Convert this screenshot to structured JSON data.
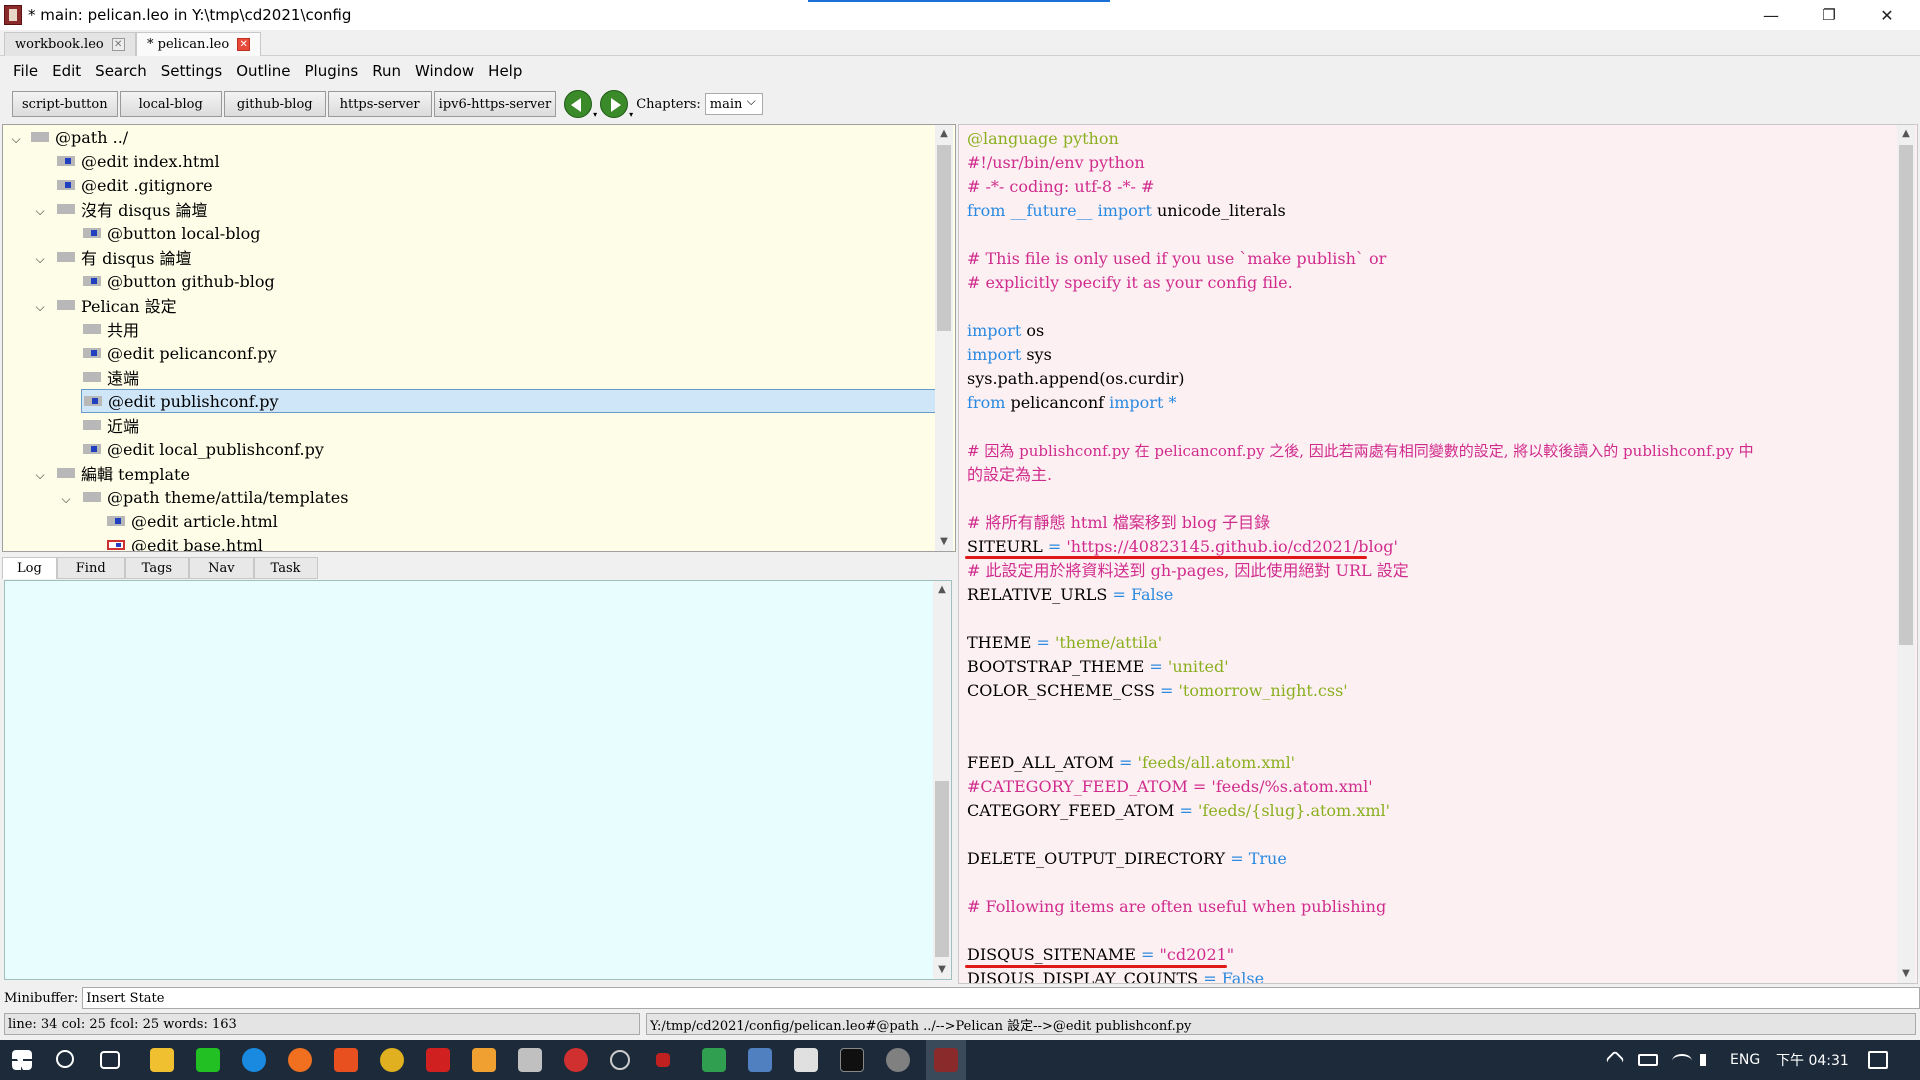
{
  "window": {
    "title": "* main: pelican.leo in Y:\\tmp\\cd2021\\config",
    "minimize": "—",
    "restore": "❐",
    "close": "✕"
  },
  "doc_tabs": [
    {
      "label": "workbook.leo",
      "close": "✕"
    },
    {
      "label": "* pelican.leo",
      "close": "✕"
    }
  ],
  "menu": [
    "File",
    "Edit",
    "Search",
    "Settings",
    "Outline",
    "Plugins",
    "Run",
    "Window",
    "Help"
  ],
  "toolbar": {
    "buttons": [
      "script-button",
      "local-blog",
      "github-blog",
      "https-server",
      "ipv6-https-server"
    ],
    "chapters_label": "Chapters:",
    "chapters_value": "main",
    "arrow_drop": "▾"
  },
  "outline": {
    "chev_open": "⌵",
    "nodes": [
      {
        "text": "@path ../"
      },
      {
        "text": "@edit index.html"
      },
      {
        "text": "@edit .gitignore"
      },
      {
        "text": "沒有 disqus 論壇"
      },
      {
        "text": "@button local-blog"
      },
      {
        "text": "有 disqus 論壇"
      },
      {
        "text": "@button github-blog"
      },
      {
        "text": "Pelican 設定"
      },
      {
        "text": "共用"
      },
      {
        "text": "@edit pelicanconf.py"
      },
      {
        "text": "遠端"
      },
      {
        "text": "@edit publishconf.py"
      },
      {
        "text": "近端"
      },
      {
        "text": "@edit local_publishconf.py"
      },
      {
        "text": "編輯 template"
      },
      {
        "text": "@path theme/attila/templates"
      },
      {
        "text": "@edit article.html"
      },
      {
        "text": "@edit base.html"
      }
    ]
  },
  "bottom_tabs": [
    "Log",
    "Find",
    "Tags",
    "Nav",
    "Task"
  ],
  "body": {
    "l1": "@language python",
    "l2": "#!/usr/bin/env python",
    "l3": "# -*- coding: utf-8 -*- #",
    "l4a": "from",
    "l4b": "__future__",
    "l4c": "import",
    "l4d": "unicode_literals",
    "l6": "# This file is only used if you use `make publish` or",
    "l7": "# explicitly specify it as your config file.",
    "l9a": "import",
    "l9b": "os",
    "l10a": "import",
    "l10b": "sys",
    "l11": "sys.path.append(os.curdir)",
    "l12a": "from",
    "l12b": "pelicanconf",
    "l12c": "import",
    "l12d": "*",
    "l14": "# 因為 publishconf.py 在 pelicanconf.py 之後, 因此若兩處有相同變數的設定, 將以較後讀入的 publishconf.py 中",
    "l15": "的設定為主.",
    "l17": "# 將所有靜態 html 檔案移到 blog 子目錄",
    "l18a": "SITEURL",
    "l18b": "=",
    "l18c": "'https://40823145.github.io/cd2021/blog'",
    "l19": "# 此設定用於將資料送到 gh-pages, 因此使用絕對 URL 設定",
    "l20a": "RELATIVE_URLS",
    "l20b": "=",
    "l20c": "False",
    "l22a": "THEME",
    "l22b": "=",
    "l22c": "'theme/attila'",
    "l23a": "BOOTSTRAP_THEME",
    "l23b": "=",
    "l23c": "'united'",
    "l24a": "COLOR_SCHEME_CSS",
    "l24b": "=",
    "l24c": "'tomorrow_night.css'",
    "l27a": "FEED_ALL_ATOM",
    "l27b": "=",
    "l27c": "'feeds/all.atom.xml'",
    "l28": "#CATEGORY_FEED_ATOM = 'feeds/%s.atom.xml'",
    "l29a": "CATEGORY_FEED_ATOM",
    "l29b": "=",
    "l29c": "'feeds/{slug}.atom.xml'",
    "l31a": "DELETE_OUTPUT_DIRECTORY",
    "l31b": "=",
    "l31c": "True",
    "l33": "# Following items are often useful when publishing",
    "l35a": "DISQUS_SITENAME",
    "l35b": "=",
    "l35c": "\"cd2021\"",
    "l36a": "DISQUS_DISPLAY_COUNTS",
    "l36b": "=",
    "l36c": "False"
  },
  "minibuffer": {
    "label": "Minibuffer:",
    "value": "Insert State"
  },
  "status": {
    "left": "line: 34 col: 25  fcol: 25 words: 163",
    "right": "Y:/tmp/cd2021/config/pelican.leo#@path ../-->Pelican 設定-->@edit publishconf.py"
  },
  "scroll": {
    "up": "▲",
    "down": "▼"
  },
  "taskbar": {
    "lang": "ENG",
    "time": "下午 04:31"
  },
  "colors": {
    "outline_bg": "#fefee8",
    "body_bg": "#fdf0f3",
    "log_bg": "#e8fefe",
    "comment": "#d02c8c",
    "keyword": "#2a8ae0",
    "string": "#8ab020",
    "highlight_underline": "#e01818"
  }
}
